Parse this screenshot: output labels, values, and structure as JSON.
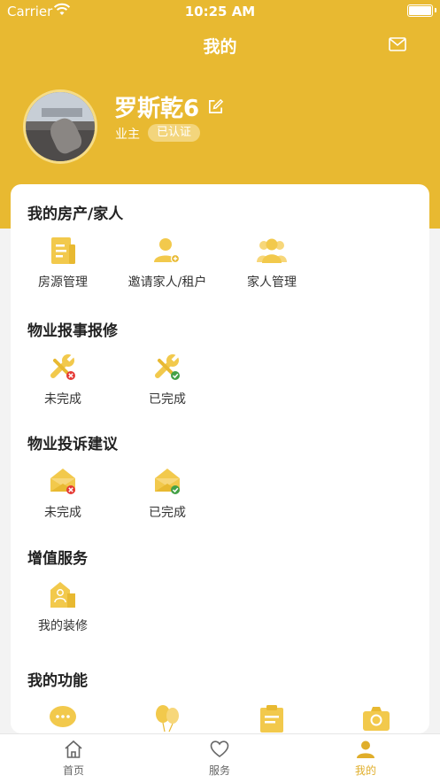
{
  "status_bar": {
    "carrier": "Carrier",
    "time": "10:25 AM"
  },
  "nav": {
    "title": "我的",
    "right_icon": "mail-icon"
  },
  "profile": {
    "name": "罗斯乾6",
    "role": "业主",
    "badge": "已认证"
  },
  "sections": [
    {
      "title": "我的房产/家人",
      "items": [
        {
          "label": "房源管理",
          "icon": "document-icon"
        },
        {
          "label": "邀请家人/租户",
          "icon": "invite-person-icon"
        },
        {
          "label": "家人管理",
          "icon": "family-icon"
        }
      ]
    },
    {
      "title": "物业报事报修",
      "items": [
        {
          "label": "未完成",
          "icon": "wrench-incomplete-icon"
        },
        {
          "label": "已完成",
          "icon": "wrench-complete-icon"
        }
      ]
    },
    {
      "title": "物业投诉建议",
      "items": [
        {
          "label": "未完成",
          "icon": "envelope-incomplete-icon"
        },
        {
          "label": "已完成",
          "icon": "envelope-complete-icon"
        }
      ]
    },
    {
      "title": "增值服务",
      "items": [
        {
          "label": "我的装修",
          "icon": "decoration-icon"
        }
      ]
    },
    {
      "title": "我的功能",
      "items": [
        {
          "label": "",
          "icon": "chat-bubble-icon"
        },
        {
          "label": "",
          "icon": "balloon-icon"
        },
        {
          "label": "",
          "icon": "clipboard-icon"
        },
        {
          "label": "",
          "icon": "camera-icon"
        }
      ]
    }
  ],
  "tabbar": [
    {
      "label": "首页",
      "icon": "home-icon",
      "active": false
    },
    {
      "label": "服务",
      "icon": "heart-icon",
      "active": false
    },
    {
      "label": "我的",
      "icon": "person-icon",
      "active": true
    }
  ],
  "colors": {
    "accent": "#e8b931",
    "icon_yellow": "#f2c94c",
    "error_red": "#e53935",
    "success_green": "#43a047"
  }
}
